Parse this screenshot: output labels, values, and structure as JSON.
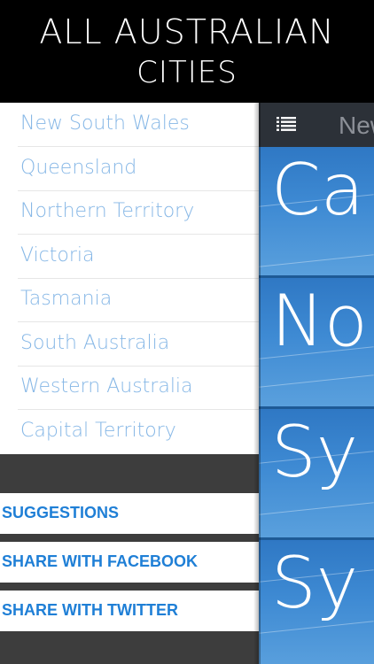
{
  "banner": {
    "line1": "ALL AUSTRALIAN",
    "line2": "CITIES"
  },
  "main": {
    "nav_title": "New",
    "tiles": [
      {
        "text": "Ca"
      },
      {
        "text": "No"
      },
      {
        "text": "Sy"
      },
      {
        "text": "Sy"
      }
    ]
  },
  "drawer": {
    "states": [
      {
        "label": "New South Wales"
      },
      {
        "label": "Queensland"
      },
      {
        "label": "Northern Territory"
      },
      {
        "label": "Victoria"
      },
      {
        "label": "Tasmania"
      },
      {
        "label": "South Australia"
      },
      {
        "label": "Western Australia"
      },
      {
        "label": "Capital Territory"
      }
    ],
    "actions": [
      {
        "label": "SUGGESTIONS"
      },
      {
        "label": "SHARE WITH FACEBOOK"
      },
      {
        "label": "SHARE WITH TWITTER"
      }
    ]
  },
  "colors": {
    "state_text": "#86b7e6",
    "action_text": "#1f7fd6",
    "navbar": "#2c3138",
    "drawer_bg": "#3d3d3d"
  },
  "icons": {
    "menu": "list-menu-icon"
  }
}
